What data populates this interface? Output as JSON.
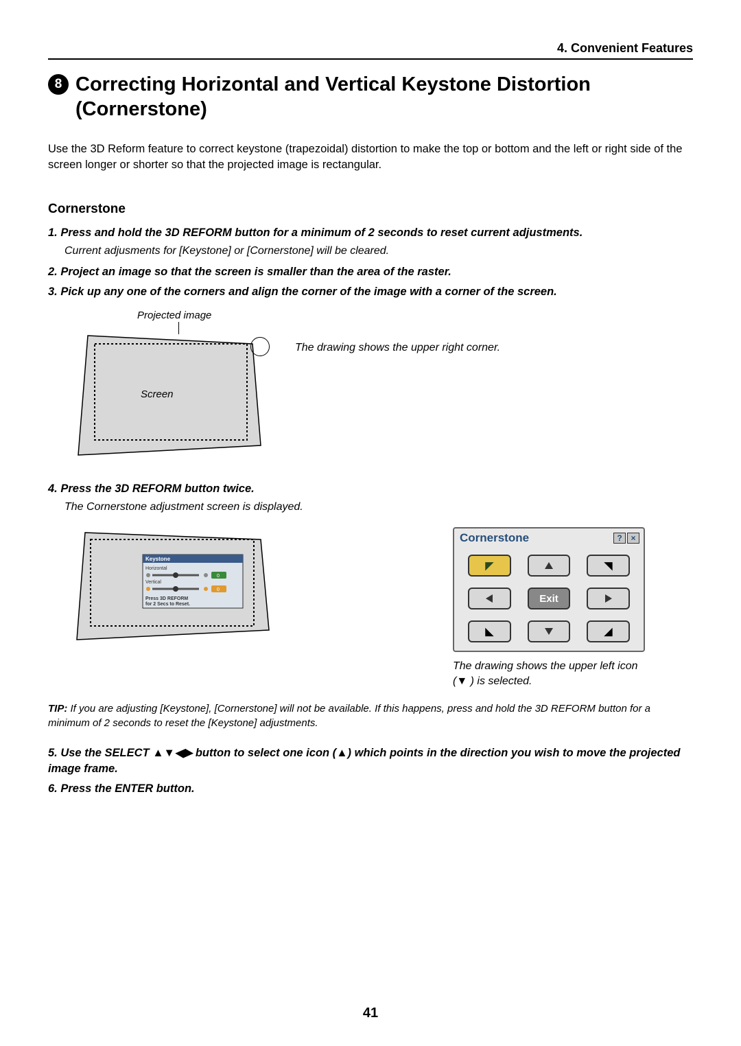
{
  "header": {
    "chapter": "4. Convenient Features"
  },
  "section_number": "8",
  "main_title": "Correcting Horizontal and Vertical Keystone Distortion (Cornerstone)",
  "intro": "Use the 3D Reform feature to correct keystone (trapezoidal) distortion to make the top or bottom and the left or right side of the screen longer or shorter so that the projected image is rectangular.",
  "sub_heading": "Cornerstone",
  "steps": {
    "s1": "1.  Press and hold the 3D REFORM button for a minimum of 2 seconds to reset current adjustments.",
    "s1_note": "Current adjusments for [Keystone] or [Cornerstone] will be cleared.",
    "s2": "2.  Project an image so that the screen is smaller than the area of the raster.",
    "s3": "3.  Pick up any one of the corners and align the corner of the image with a corner of the screen.",
    "s4": "4.  Press the 3D REFORM button twice.",
    "s4_note": "The Cornerstone adjustment screen is displayed.",
    "s5_a": "5.  Use the SELECT ",
    "s5_b": " button to select one icon (",
    "s5_c": ") which points in the direction you wish to move the projected image frame.",
    "s6": "6.  Press the ENTER button."
  },
  "fig1": {
    "projected_label": "Projected image",
    "screen_label": "Screen",
    "caption": "The drawing shows the upper right corner."
  },
  "fig2": {
    "keystone_title": "Keystone",
    "horizontal": "Horizontal",
    "vertical": "Vertical",
    "value": "0",
    "reset_hint_a": "Press 3D REFORM",
    "reset_hint_b": "for 2 Secs to Reset."
  },
  "cornerstone_window": {
    "title": "Cornerstone",
    "exit": "Exit",
    "caption_a": "The drawing shows the upper left icon (",
    "caption_b": " ) is selected."
  },
  "tip": {
    "label": "TIP:",
    "body": " If you are adjusting [Keystone], [Cornerstone] will not be available. If this happens, press and hold the 3D REFORM button for a minimum of 2 seconds to reset the [Keystone] adjustments."
  },
  "page_number": "41"
}
